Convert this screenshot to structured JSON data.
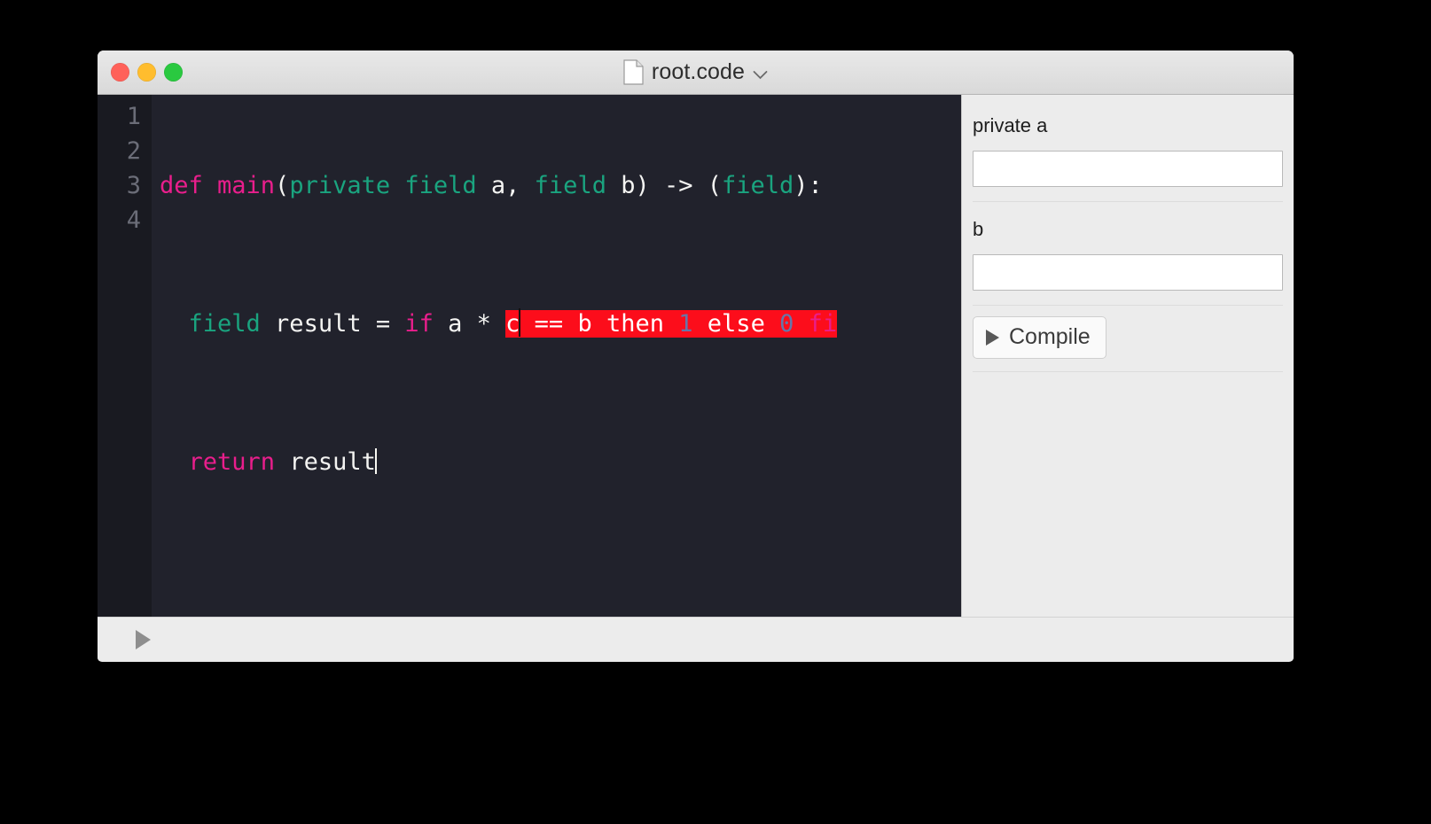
{
  "window": {
    "title": "root.code",
    "title_icon": "document-icon",
    "title_chevron": "chevron-down-icon",
    "traffic_lights": [
      {
        "name": "close",
        "color": "#ff6159"
      },
      {
        "name": "minimize",
        "color": "#ffbd2e"
      },
      {
        "name": "maximize",
        "color": "#2ac940"
      }
    ]
  },
  "editor": {
    "language": "zokrates",
    "background": "#21222c",
    "gutter_background": "#191a21",
    "line_numbers": [
      "1",
      "2",
      "3",
      "4"
    ],
    "error_highlight_color": "#fc0d1b",
    "lines": [
      {
        "number": "1",
        "text": "def main(private field a, field b) -> (field):",
        "tokens": [
          {
            "t": "def main",
            "cls": "kw"
          },
          {
            "t": "(",
            "cls": "plain"
          },
          {
            "t": "private field",
            "cls": "type"
          },
          {
            "t": " a, ",
            "cls": "plain"
          },
          {
            "t": "field",
            "cls": "type"
          },
          {
            "t": " b) -> (",
            "cls": "plain"
          },
          {
            "t": "field",
            "cls": "type"
          },
          {
            "t": "):",
            "cls": "plain"
          }
        ]
      },
      {
        "number": "2",
        "text": "  field result = if a * c == b then 1 else 0 fi",
        "tokens": [
          {
            "t": "  ",
            "cls": "plain"
          },
          {
            "t": "field",
            "cls": "type"
          },
          {
            "t": " result = ",
            "cls": "plain"
          },
          {
            "t": "if",
            "cls": "kw"
          },
          {
            "t": " a * ",
            "cls": "plain"
          }
        ],
        "highlight_tokens": [
          {
            "t": "c",
            "cls": "plain"
          },
          {
            "t": " == b ",
            "cls": "plain"
          },
          {
            "t": "then",
            "cls": "plain"
          },
          {
            "t": " ",
            "cls": "plain"
          },
          {
            "t": "1",
            "cls": "num"
          },
          {
            "t": " ",
            "cls": "plain"
          },
          {
            "t": "else",
            "cls": "plain"
          },
          {
            "t": " ",
            "cls": "plain"
          },
          {
            "t": "0",
            "cls": "num"
          },
          {
            "t": " ",
            "cls": "plain"
          },
          {
            "t": "fi",
            "cls": "kw"
          }
        ]
      },
      {
        "number": "3",
        "text": "  return result",
        "tokens": [
          {
            "t": "  ",
            "cls": "plain"
          },
          {
            "t": "return",
            "cls": "kw"
          },
          {
            "t": " result",
            "cls": "plain"
          }
        ]
      },
      {
        "number": "4",
        "text": "",
        "tokens": []
      }
    ]
  },
  "sidebar": {
    "fields": [
      {
        "label": "private a",
        "value": "",
        "placeholder": ""
      },
      {
        "label": "b",
        "value": "",
        "placeholder": ""
      }
    ],
    "compile": {
      "label": "Compile",
      "icon": "play-triangle-icon"
    }
  },
  "bottombar": {
    "toggle_icon": "play-triangle-icon"
  },
  "colors": {
    "keyword": "#e91e8c",
    "type": "#1aa47f",
    "plain": "#f4f4f2",
    "number": "#6775a8",
    "error_bg": "#fc0d1b"
  }
}
